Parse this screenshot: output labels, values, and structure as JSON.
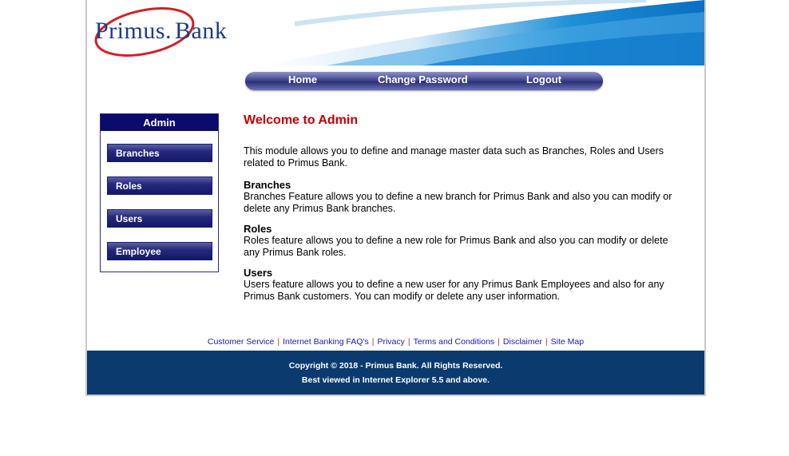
{
  "brand": {
    "logo_primary": "Primus.",
    "logo_secondary": "Bank",
    "colors": {
      "nav": "#3f4690",
      "footer": "#0b3a6e",
      "welcome": "#c00000",
      "sidebar_title": "#0b0b6b"
    }
  },
  "nav": {
    "home": "Home",
    "change_password": "Change Password",
    "logout": "Logout"
  },
  "sidebar": {
    "title": "Admin",
    "items": [
      {
        "label": "Branches"
      },
      {
        "label": "Roles"
      },
      {
        "label": "Users"
      },
      {
        "label": "Employee"
      }
    ]
  },
  "main": {
    "welcome": "Welcome to Admin",
    "intro": "This module allows you to define and manage master data such as Branches, Roles and Users related to Primus Bank.",
    "sections": [
      {
        "heading": "Branches",
        "text": "Branches Feature allows you to define a new branch for Primus Bank and also you can modify or delete any Primus Bank branches."
      },
      {
        "heading": "Roles",
        "text": "Roles feature allows you to define a new role for Primus Bank and also you can modify or delete any Primus Bank roles."
      },
      {
        "heading": "Users",
        "text": "Users feature allows you to define a new user for any Primus Bank Employees and also for any Primus Bank customers. You can modify or delete any user information."
      }
    ]
  },
  "footer_links": {
    "customer_service": "Customer Service",
    "faq": "Internet Banking FAQ's",
    "privacy": "Privacy",
    "terms": "Terms and Conditions",
    "disclaimer": "Disclaimer",
    "site_map": "Site Map",
    "separator": "|"
  },
  "footer": {
    "copyright": "Copyright © 2018 - Primus Bank. All Rights Reserved.",
    "browser_note": "Best viewed in Internet Explorer 5.5 and above."
  }
}
